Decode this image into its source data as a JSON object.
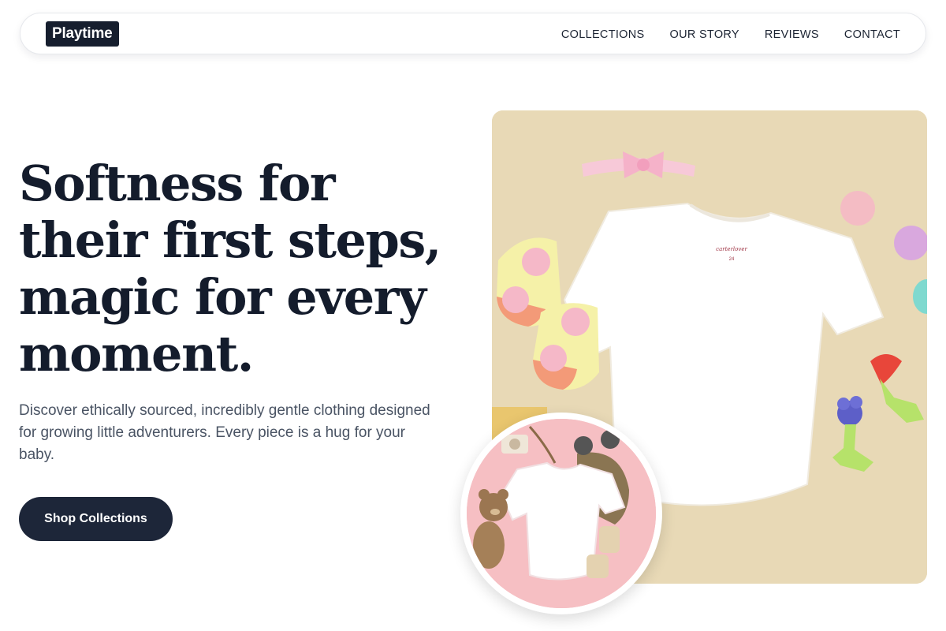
{
  "brand": {
    "name": "Playtime"
  },
  "nav": {
    "items": [
      "COLLECTIONS",
      "OUR STORY",
      "REVIEWS",
      "CONTACT"
    ]
  },
  "hero": {
    "headline_lines": [
      "Softness for",
      "their first steps,",
      "magic for every",
      "moment."
    ],
    "description": "Discover ethically sourced, incredibly gentle clothing designed for growing little adventurers. Every piece is a hug for your baby.",
    "cta_label": "Shop Collections"
  },
  "images": {
    "main": {
      "subject": "white baby t-shirt flat lay with socks, bow headband, macarons and teethers",
      "tag_text": "carterlover",
      "tag_size": "24"
    },
    "circle": {
      "subject": "white baby t-shirt on pink background with teddy bear and knit hat"
    }
  },
  "colors": {
    "ink": "#141c2c",
    "button": "#1d2639",
    "body_text": "#4a5464",
    "photo_bg": "#e8d9b6",
    "circle_bg": "#f6bfc3"
  }
}
